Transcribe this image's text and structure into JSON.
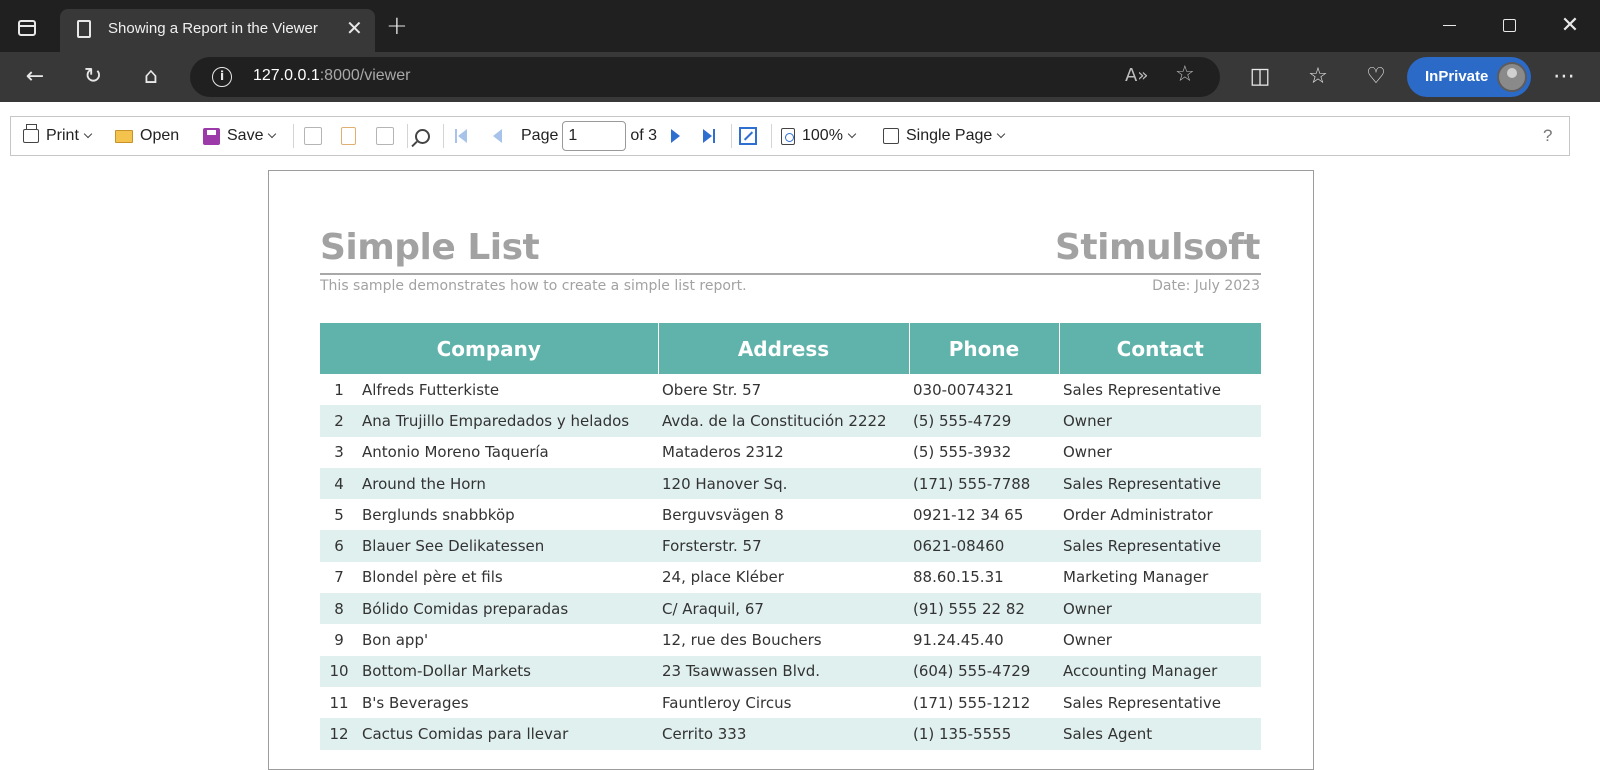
{
  "browser": {
    "tab_title": "Showing a Report in the Viewer",
    "address_host": "127.0.0.1",
    "address_rest": ":8000/viewer",
    "inprivate_label": "InPrivate"
  },
  "toolbar": {
    "print_label": "Print",
    "open_label": "Open",
    "save_label": "Save",
    "page_label": "Page",
    "page_value": "1",
    "page_of": "of 3",
    "zoom_label": "100%",
    "view_mode_label": "Single Page",
    "help_label": "?"
  },
  "report": {
    "title": "Simple List",
    "brand": "Stimulsoft",
    "description": "This sample demonstrates how to create a simple list report.",
    "date": "Date: July 2023",
    "columns": [
      "Company",
      "Address",
      "Phone",
      "Contact"
    ],
    "rows": [
      {
        "num": "1",
        "company": "Alfreds Futterkiste",
        "address": "Obere Str. 57",
        "phone": "030-0074321",
        "contact": "Sales Representative"
      },
      {
        "num": "2",
        "company": "Ana Trujillo Emparedados y helados",
        "address": "Avda. de la Constitución 2222",
        "phone": "(5) 555-4729",
        "contact": "Owner"
      },
      {
        "num": "3",
        "company": "Antonio Moreno Taquería",
        "address": "Mataderos 2312",
        "phone": "(5) 555-3932",
        "contact": "Owner"
      },
      {
        "num": "4",
        "company": "Around the Horn",
        "address": "120 Hanover Sq.",
        "phone": "(171) 555-7788",
        "contact": "Sales Representative"
      },
      {
        "num": "5",
        "company": "Berglunds snabbköp",
        "address": "Berguvsvägen 8",
        "phone": "0921-12 34 65",
        "contact": "Order Administrator"
      },
      {
        "num": "6",
        "company": "Blauer See Delikatessen",
        "address": "Forsterstr. 57",
        "phone": "0621-08460",
        "contact": "Sales Representative"
      },
      {
        "num": "7",
        "company": "Blondel père et fils",
        "address": "24, place Kléber",
        "phone": "88.60.15.31",
        "contact": "Marketing Manager"
      },
      {
        "num": "8",
        "company": "Bólido Comidas preparadas",
        "address": "C/ Araquil, 67",
        "phone": "(91) 555 22 82",
        "contact": "Owner"
      },
      {
        "num": "9",
        "company": "Bon app'",
        "address": "12, rue des Bouchers",
        "phone": "91.24.45.40",
        "contact": "Owner"
      },
      {
        "num": "10",
        "company": "Bottom-Dollar Markets",
        "address": "23 Tsawwassen Blvd.",
        "phone": "(604) 555-4729",
        "contact": "Accounting Manager"
      },
      {
        "num": "11",
        "company": "B's Beverages",
        "address": "Fauntleroy Circus",
        "phone": "(171) 555-1212",
        "contact": "Sales Representative"
      },
      {
        "num": "12",
        "company": "Cactus Comidas para llevar",
        "address": "Cerrito 333",
        "phone": "(1) 135-5555",
        "contact": "Sales Agent"
      }
    ]
  },
  "colors": {
    "header_teal": "#5fb3ab",
    "stripe": "#e0f0ef",
    "inprivate_blue": "#2b6ac7"
  }
}
